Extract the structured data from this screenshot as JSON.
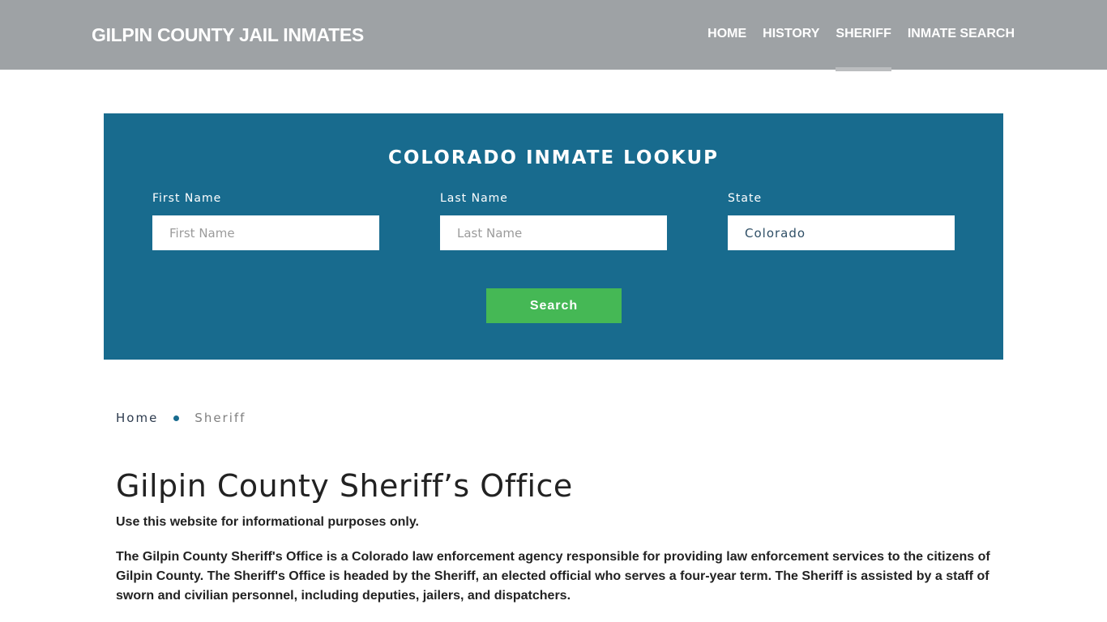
{
  "header": {
    "brand": "GILPIN COUNTY JAIL INMATES",
    "nav": [
      {
        "label": "HOME",
        "active": false
      },
      {
        "label": "HISTORY",
        "active": false
      },
      {
        "label": "SHERIFF",
        "active": true
      },
      {
        "label": "INMATE SEARCH",
        "active": false
      }
    ]
  },
  "lookup": {
    "title": "COLORADO INMATE LOOKUP",
    "first_name": {
      "label": "First Name",
      "placeholder": "First Name",
      "value": ""
    },
    "last_name": {
      "label": "Last Name",
      "placeholder": "Last Name",
      "value": ""
    },
    "state": {
      "label": "State",
      "value": "Colorado"
    },
    "search_label": "Search",
    "colors": {
      "panel": "#186b8e",
      "button": "#45b855"
    }
  },
  "breadcrumb": {
    "home": "Home",
    "current": "Sheriff"
  },
  "content": {
    "title": "Gilpin County Sheriff’s Office",
    "intro": "Use this website for informational purposes only.",
    "paragraph": "The Gilpin County Sheriff's Office is a Colorado law enforcement agency responsible for providing law enforcement services to the citizens of Gilpin County. The Sheriff's Office is headed by the Sheriff, an elected official who serves a four-year term. The Sheriff is assisted by a staff of sworn and civilian personnel, including deputies, jailers, and dispatchers."
  }
}
